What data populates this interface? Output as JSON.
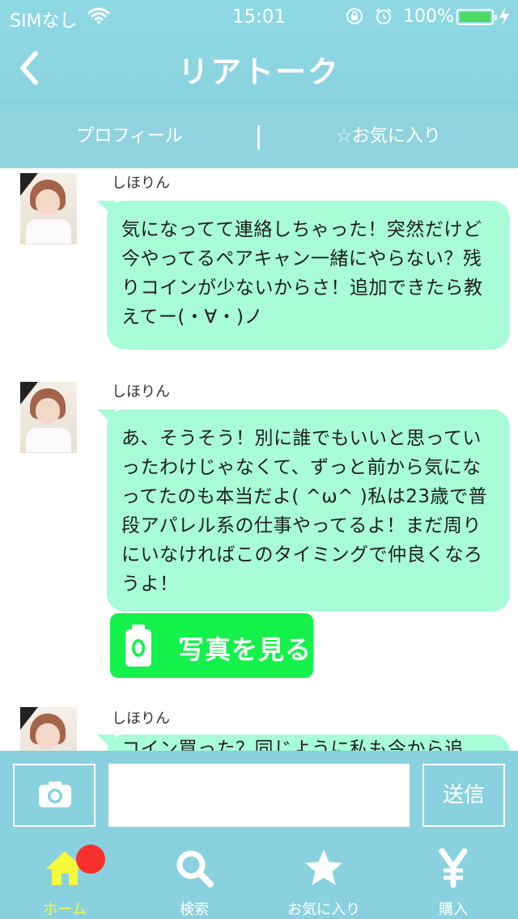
{
  "status_bar": {
    "carrier": "SIMなし",
    "time": "15:01",
    "battery_percent": "100%",
    "battery_level": 1.0,
    "icons": [
      "wifi-icon",
      "rotation-lock-icon",
      "alarm-icon",
      "battery-icon",
      "charging-icon"
    ]
  },
  "nav": {
    "title": "リアトーク",
    "back_icon": "chevron-left-icon"
  },
  "top_tabs": {
    "profile": "プロフィール",
    "favorite": "☆お気に入り"
  },
  "messages": [
    {
      "sender": "しほりん",
      "text": "気になってて連絡しちゃった！突然だけど今やってるペアキャン一緒にやらない？残りコインが少ないからさ！追加できたら教えてー(・∀・)ノ"
    },
    {
      "sender": "しほりん",
      "text": "あ、そうそう！別に誰でもいいと思っていったわけじゃなくて、ずっと前から気になってたのも本当だよ( ^ω^ )私は23歳で普段アパレル系の仕事やってるよ！まだ周りにいなければこのタイミングで仲良くなろうよ！",
      "photo_button_label": "写真を見る"
    },
    {
      "sender": "しほりん",
      "text": "コイン買った？同じように私も今から追"
    }
  ],
  "composer": {
    "camera_icon": "camera-icon",
    "input_value": "",
    "send_label": "送信"
  },
  "bottom_tabs": [
    {
      "label": "ホーム",
      "icon": "home-icon",
      "active": true
    },
    {
      "label": "検索",
      "icon": "search-icon",
      "active": false
    },
    {
      "label": "お気に入り",
      "icon": "star-icon",
      "active": false
    },
    {
      "label": "購入",
      "icon": "yen-icon",
      "active": false
    }
  ],
  "colors": {
    "header": "#8fd9e4",
    "bubble": "#a8fcd8",
    "photo_button": "#14f14b",
    "active_tab": "#f5f93a",
    "badge": "#f7302d"
  }
}
